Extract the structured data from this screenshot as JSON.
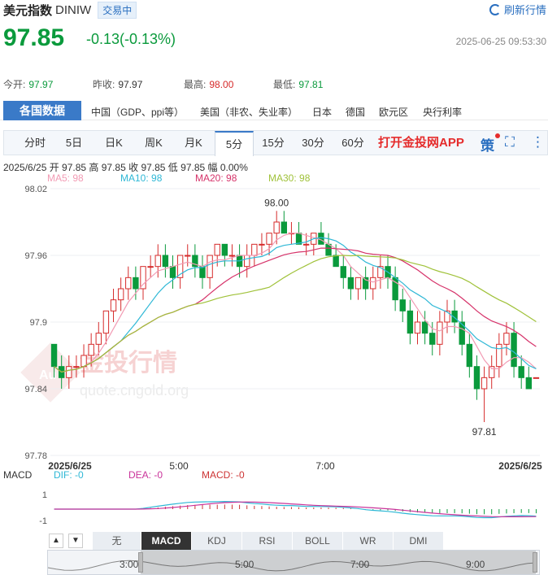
{
  "header": {
    "name": "美元指数",
    "code": "DINIW",
    "status": "交易中",
    "refresh_label": "刷新行情",
    "price": "97.85",
    "change": "-0.13(-0.13%)",
    "timestamp": "2025-06-25 09:53:30"
  },
  "stats": [
    {
      "label": "今开:",
      "value": "97.97",
      "color": "green"
    },
    {
      "label": "昨收:",
      "value": "97.97",
      "color": "neutral"
    },
    {
      "label": "最高:",
      "value": "98.00",
      "color": "red"
    },
    {
      "label": "最低:",
      "value": "97.81",
      "color": "green"
    }
  ],
  "nav": {
    "active": "各国数据",
    "items": [
      "中国（GDP、ppi等）",
      "美国（非农、失业率）",
      "日本",
      "德国",
      "欧元区",
      "央行利率"
    ]
  },
  "periods": {
    "items": [
      "分时",
      "5日",
      "日K",
      "周K",
      "月K",
      "5分",
      "15分",
      "30分",
      "60分"
    ],
    "active_index": 5,
    "app_link": "打开金投网APP",
    "tools": [
      "策",
      "⛶",
      "⋮"
    ]
  },
  "ohlc_text": "2025/6/25  开 97.85  高 97.85  收 97.85  低 97.85  幅 0.00%",
  "ma": [
    {
      "label": "MA5: 98",
      "color": "#f29bb4"
    },
    {
      "label": "MA10: 98",
      "color": "#2fb8d6"
    },
    {
      "label": "MA20: 98",
      "color": "#d6336a"
    },
    {
      "label": "MA30: 98",
      "color": "#a0c23a"
    }
  ],
  "chart_data": {
    "type": "candlestick",
    "y_ticks": [
      "98.02",
      "97.96",
      "97.9",
      "97.84",
      "97.78"
    ],
    "ylim": [
      97.78,
      98.02
    ],
    "x_labels": [
      "2025/6/25",
      "5:00",
      "7:00",
      "2025/6/25"
    ],
    "annotations": [
      {
        "text": "98.00",
        "value": 98.0
      },
      {
        "text": "97.81",
        "value": 97.81
      }
    ],
    "watermark": {
      "brand": "金投行情",
      "url": "quote.cngold.org",
      "logo_text": "Au"
    },
    "colors": {
      "up": "#d62b2b",
      "down": "#0a9a3c",
      "ma5": "#f29bb4",
      "ma10": "#2fb8d6",
      "ma20": "#d6336a",
      "ma30": "#a0c23a"
    },
    "candles": [
      [
        97.88,
        97.88,
        97.85,
        97.86
      ],
      [
        97.86,
        97.87,
        97.84,
        97.85
      ],
      [
        97.85,
        97.87,
        97.84,
        97.86
      ],
      [
        97.86,
        97.87,
        97.85,
        97.86
      ],
      [
        97.86,
        97.88,
        97.85,
        97.87
      ],
      [
        97.87,
        97.89,
        97.86,
        97.88
      ],
      [
        97.88,
        97.9,
        97.87,
        97.89
      ],
      [
        97.89,
        97.91,
        97.88,
        97.91
      ],
      [
        97.91,
        97.93,
        97.9,
        97.92
      ],
      [
        97.92,
        97.94,
        97.91,
        97.93
      ],
      [
        97.93,
        97.95,
        97.92,
        97.94
      ],
      [
        97.94,
        97.95,
        97.92,
        97.93
      ],
      [
        97.93,
        97.95,
        97.92,
        97.95
      ],
      [
        97.95,
        97.96,
        97.94,
        97.95
      ],
      [
        97.95,
        97.97,
        97.94,
        97.96
      ],
      [
        97.96,
        97.97,
        97.94,
        97.95
      ],
      [
        97.95,
        97.96,
        97.93,
        97.94
      ],
      [
        97.94,
        97.96,
        97.93,
        97.96
      ],
      [
        97.96,
        97.97,
        97.95,
        97.96
      ],
      [
        97.96,
        97.97,
        97.94,
        97.95
      ],
      [
        97.95,
        97.96,
        97.93,
        97.94
      ],
      [
        97.94,
        97.96,
        97.93,
        97.96
      ],
      [
        97.96,
        97.97,
        97.95,
        97.97
      ],
      [
        97.97,
        97.97,
        97.95,
        97.96
      ],
      [
        97.96,
        97.97,
        97.95,
        97.96
      ],
      [
        97.96,
        97.97,
        97.94,
        97.95
      ],
      [
        97.95,
        97.97,
        97.94,
        97.96
      ],
      [
        97.96,
        97.97,
        97.95,
        97.97
      ],
      [
        97.97,
        97.98,
        97.96,
        97.97
      ],
      [
        97.97,
        97.98,
        97.96,
        97.98
      ],
      [
        97.98,
        98.0,
        97.97,
        97.99
      ],
      [
        97.99,
        98.0,
        97.98,
        97.98
      ],
      [
        97.98,
        97.99,
        97.97,
        97.98
      ],
      [
        97.98,
        97.99,
        97.97,
        97.97
      ],
      [
        97.97,
        97.98,
        97.96,
        97.97
      ],
      [
        97.97,
        97.98,
        97.96,
        97.98
      ],
      [
        97.98,
        97.99,
        97.97,
        97.97
      ],
      [
        97.97,
        97.98,
        97.96,
        97.96
      ],
      [
        97.96,
        97.97,
        97.95,
        97.95
      ],
      [
        97.95,
        97.96,
        97.93,
        97.94
      ],
      [
        97.94,
        97.95,
        97.92,
        97.93
      ],
      [
        97.93,
        97.94,
        97.92,
        97.94
      ],
      [
        97.94,
        97.95,
        97.92,
        97.93
      ],
      [
        97.93,
        97.95,
        97.92,
        97.94
      ],
      [
        97.94,
        97.96,
        97.93,
        97.95
      ],
      [
        97.95,
        97.96,
        97.93,
        97.94
      ],
      [
        97.94,
        97.95,
        97.91,
        97.92
      ],
      [
        97.92,
        97.93,
        97.9,
        97.91
      ],
      [
        97.91,
        97.92,
        97.88,
        97.89
      ],
      [
        97.89,
        97.91,
        97.88,
        97.9
      ],
      [
        97.9,
        97.91,
        97.88,
        97.89
      ],
      [
        97.89,
        97.9,
        97.87,
        97.88
      ],
      [
        97.88,
        97.91,
        97.87,
        97.9
      ],
      [
        97.9,
        97.92,
        97.89,
        97.91
      ],
      [
        97.91,
        97.92,
        97.89,
        97.9
      ],
      [
        97.9,
        97.91,
        97.87,
        97.88
      ],
      [
        97.88,
        97.89,
        97.85,
        97.86
      ],
      [
        97.86,
        97.87,
        97.83,
        97.84
      ],
      [
        97.84,
        97.86,
        97.81,
        97.85
      ],
      [
        97.85,
        97.87,
        97.84,
        97.86
      ],
      [
        97.86,
        97.89,
        97.85,
        97.88
      ],
      [
        97.88,
        97.9,
        97.87,
        97.89
      ],
      [
        97.89,
        97.9,
        97.85,
        97.86
      ],
      [
        97.86,
        97.87,
        97.84,
        97.85
      ],
      [
        97.85,
        97.86,
        97.84,
        97.84
      ],
      [
        97.85,
        97.85,
        97.85,
        97.85
      ]
    ]
  },
  "macd": {
    "label": "MACD",
    "dif": "DIF: -0",
    "dea": "DEA: -0",
    "macd": "MACD: -0",
    "y_ticks": [
      "1",
      "-1"
    ],
    "dif_color": "#2fb8d6",
    "dea_color": "#c9339a",
    "macd_color": "#c33"
  },
  "indicators": {
    "items": [
      "无",
      "MACD",
      "KDJ",
      "RSI",
      "BOLL",
      "WR",
      "DMI"
    ],
    "active_index": 1,
    "up_arrow": "▲",
    "down_arrow": "▼"
  },
  "navigator": {
    "labels": [
      "3:00",
      "5:00",
      "7:00",
      "9:00"
    ]
  }
}
